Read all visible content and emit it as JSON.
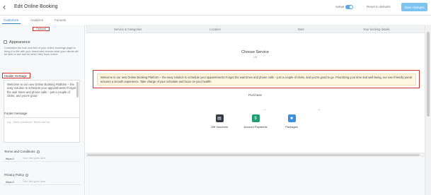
{
  "header": {
    "back_icon": "chevron-left-icon",
    "title": "Edit Online Booking",
    "active_label": "Active",
    "active_on": true,
    "reset_label": "Reset to defaults",
    "save_label": "Save changes",
    "accent_color": "#7cc3f1"
  },
  "sidebar": {
    "tabs": [
      "Customize",
      "Analytics",
      "Funnels"
    ],
    "active_tab": "Customize",
    "optional_label": "Optional",
    "appearance_title": "Appearance",
    "appearance_desc": "Customize the look and feel of your online bookings page to bring it to life with your brand and choose what your clients will be able to see and do when they book online.",
    "header_message_label": "Header message",
    "header_message_value": "Welcome to our new Online Booking Platform – the easy solution to schedule your appointments! Forget the wait times and phone calls – just a couple of clicks, and you're good",
    "footer_message_label": "Footer message",
    "footer_message_placeholder": "e.g., Have questions? Never call us",
    "terms_label": "Terms and Conditions",
    "terms_prefix": "https://",
    "terms_placeholder": "Your link goes here",
    "privacy_label": "Privacy Policy",
    "privacy_prefix": "https://",
    "privacy_placeholder": "Your link goes here"
  },
  "steps": [
    "Service & Categories",
    "Location",
    "Date",
    "Your booking details"
  ],
  "preview": {
    "heading": "Choose Service",
    "count": "1/5",
    "message": "Welcome to our new Online Booking Platform – the easy solution to schedule your appointments! Forget the wait times and phone calls – just a couple of clicks, and you're good to go. Prioritizing your time and well-being, our user-friendly portal ensures a smooth experience. Take charge of your schedule and focus on your health!",
    "purchase_label": "Purchase",
    "services": [
      {
        "label": "Gift Vouchers",
        "icon": "gift-voucher-icon",
        "color": "#2f3a45"
      },
      {
        "label": "Account Payments",
        "icon": "dollar-icon",
        "color": "#1f9d6e"
      },
      {
        "label": "Packages",
        "icon": "package-icon",
        "color": "#3b8fe0"
      }
    ]
  }
}
